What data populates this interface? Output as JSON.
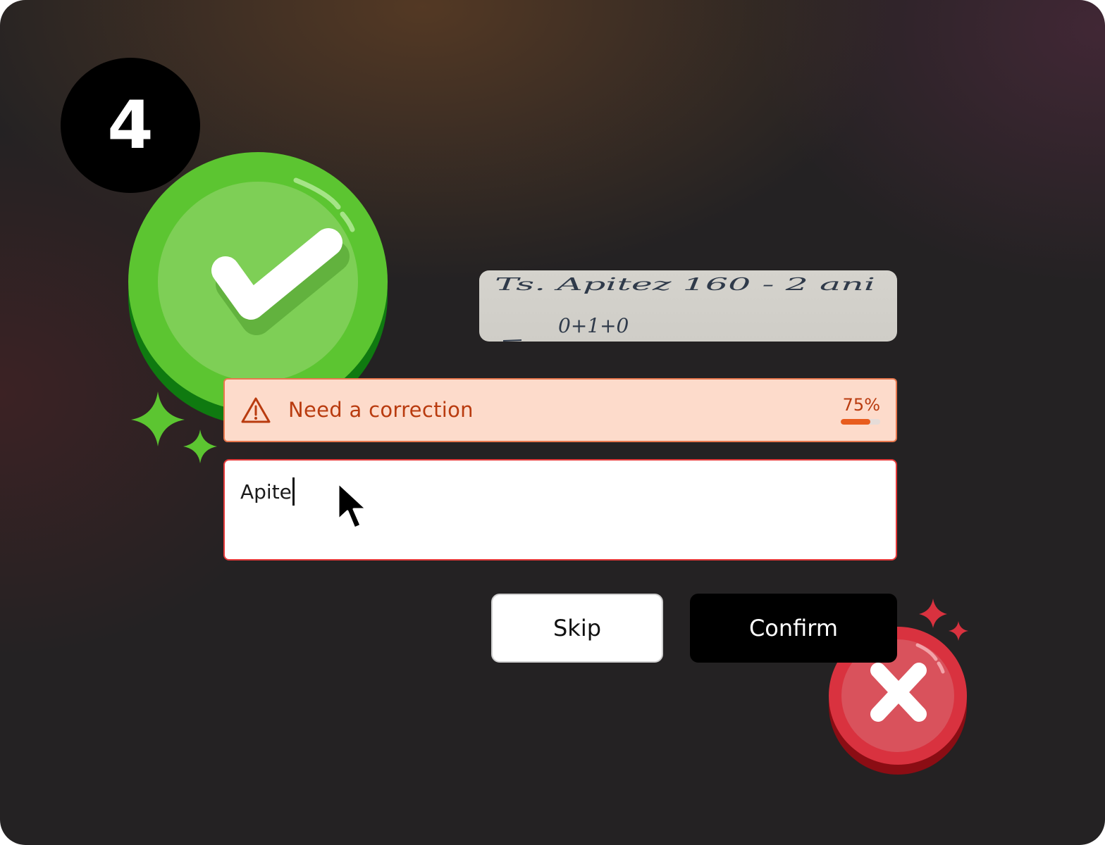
{
  "step": {
    "number": "4"
  },
  "handwriting_sample": {
    "line_1": "Ts.  Apitez 160   -   2 ani",
    "line_2": "0+1+0"
  },
  "alert": {
    "icon": "warning-triangle-icon",
    "message": "Need a correction",
    "confidence_label": "75%",
    "confidence_fraction": 0.75,
    "color": "#b93b0f",
    "background": "#fddbcb"
  },
  "correction_input": {
    "value": "Apite",
    "border_color": "#e53a3a"
  },
  "actions": {
    "skip_label": "Skip",
    "confirm_label": "Confirm"
  },
  "decorations": {
    "success_icon": "green-check-bubble-icon",
    "error_icon": "red-x-bubble-icon",
    "success_color": "#5cc531",
    "error_color": "#d9323f"
  }
}
